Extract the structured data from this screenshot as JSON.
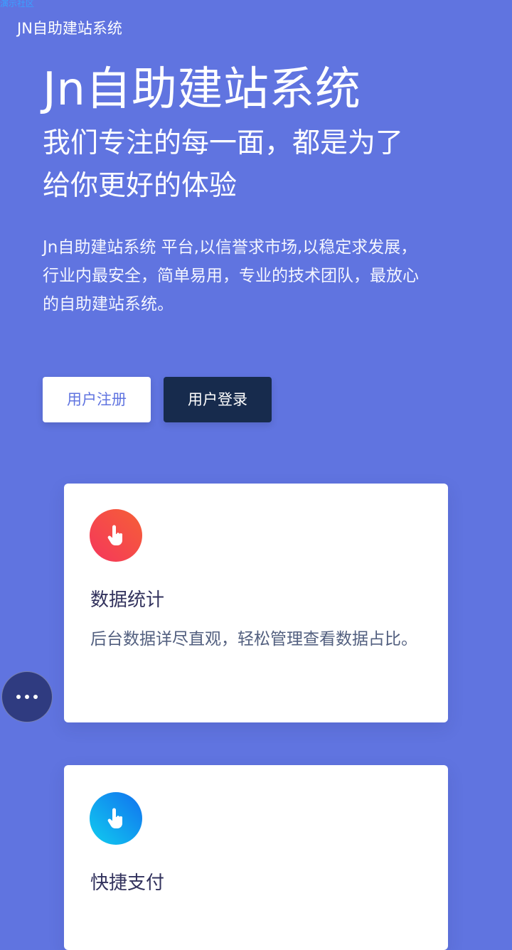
{
  "top_link": {
    "label": "演示社区"
  },
  "header": {
    "brand": "JN自助建站系统"
  },
  "hero": {
    "title": "Jn自助建站系统",
    "subtitle": "我们专注的每一面，都是为了给你更好的体验",
    "description": "Jn自助建站系统 平台,以信誉求市场,以稳定求发展，行业内最安全，简单易用，专业的技术团队，最放心的自助建站系统。"
  },
  "actions": {
    "register_label": "用户注册",
    "login_label": "用户登录"
  },
  "features": [
    {
      "icon": "hand-pointer-icon",
      "icon_gradient": [
        "#f5365c",
        "#f56036"
      ],
      "title": "数据统计",
      "description": "后台数据详尽直观，轻松管理查看数据占比。"
    },
    {
      "icon": "hand-pointer-icon",
      "icon_gradient": [
        "#11cdef",
        "#1171ef"
      ],
      "title": "快捷支付",
      "description": ""
    }
  ],
  "colors": {
    "background": "#6074e0",
    "login_button": "#172b4d",
    "card_title": "#32325d",
    "card_text": "#525f7f",
    "fab": "#2f3b80"
  },
  "floating_menu": {
    "icon": "more-dots-icon"
  }
}
